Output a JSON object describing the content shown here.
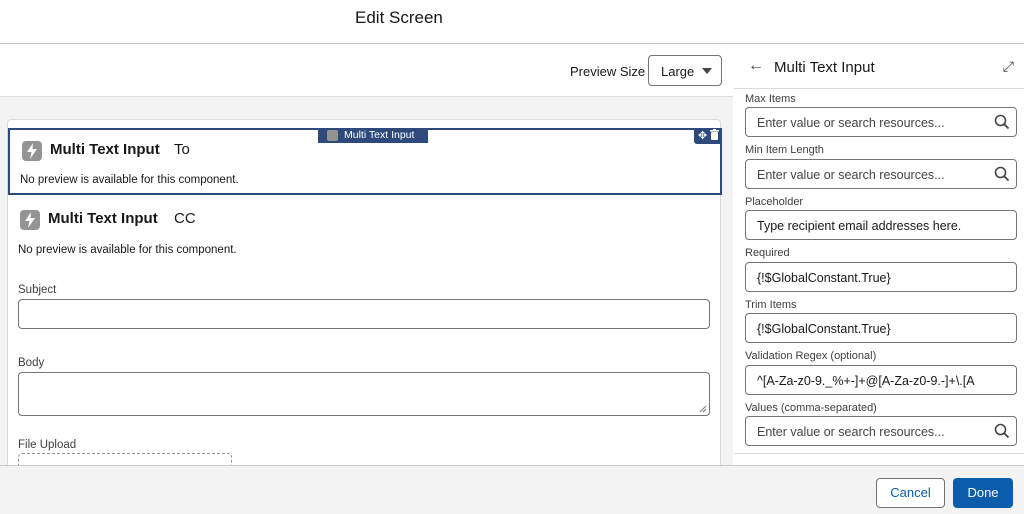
{
  "window": {
    "title": "Edit Screen"
  },
  "preview": {
    "label": "Preview Size",
    "size": "Large"
  },
  "canvas": {
    "selected_tag": "Multi Text Input",
    "components": [
      {
        "type": "Multi Text Input",
        "label": "To",
        "note": "No preview is available for this component."
      },
      {
        "type": "Multi Text Input",
        "label": "CC",
        "note": "No preview is available for this component."
      }
    ],
    "fields": [
      {
        "label": "Subject"
      },
      {
        "label": "Body"
      },
      {
        "label": "File Upload"
      }
    ]
  },
  "panel": {
    "title": "Multi Text Input",
    "properties": [
      {
        "label": "Max Items",
        "value": "",
        "placeholder": "Enter value or search resources...",
        "searchable": true
      },
      {
        "label": "Min Item Length",
        "value": "",
        "placeholder": "Enter value or search resources...",
        "searchable": true
      },
      {
        "label": "Placeholder",
        "value": "Type recipient email addresses here.",
        "placeholder": "",
        "searchable": false
      },
      {
        "label": "Required",
        "value": "{!$GlobalConstant.True}",
        "placeholder": "",
        "searchable": false
      },
      {
        "label": "Trim Items",
        "value": "{!$GlobalConstant.True}",
        "placeholder": "",
        "searchable": false
      },
      {
        "label": "Validation Regex (optional)",
        "value": "^[A-Za-z0-9._%+-]+@[A-Za-z0-9.-]+\\.[A",
        "placeholder": "",
        "searchable": false
      },
      {
        "label": "Values (comma-separated)",
        "value": "",
        "placeholder": "Enter value or search resources...",
        "searchable": true
      }
    ]
  },
  "footer": {
    "cancel_label": "Cancel",
    "done_label": "Done"
  },
  "colors": {
    "brand": "#0b5cab",
    "selection": "#2e4a7d",
    "component_icon": "#939393"
  }
}
